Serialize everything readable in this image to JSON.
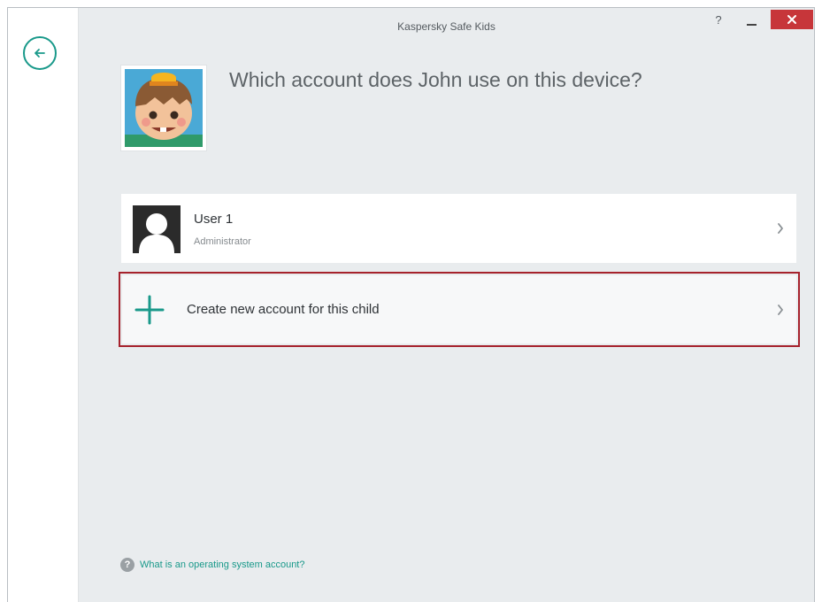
{
  "window": {
    "title": "Kaspersky Safe Kids",
    "help_label": "?",
    "close_label": "×"
  },
  "heading": "Which account does John use on this device?",
  "accounts": [
    {
      "name": "User 1",
      "role": "Administrator"
    }
  ],
  "create_account": {
    "label": "Create new account for this child"
  },
  "footer": {
    "info_icon": "?",
    "link_text": "What is an operating system account?"
  },
  "colors": {
    "accent": "#19998a",
    "highlight_border": "#a6222c",
    "close_button": "#c7363a",
    "background": "#e9ecee"
  },
  "icons": [
    "back-arrow-icon",
    "help-icon",
    "minimize-icon",
    "close-icon",
    "child-avatar-icon",
    "user-silhouette-icon",
    "chevron-right-icon",
    "plus-icon",
    "info-icon"
  ]
}
